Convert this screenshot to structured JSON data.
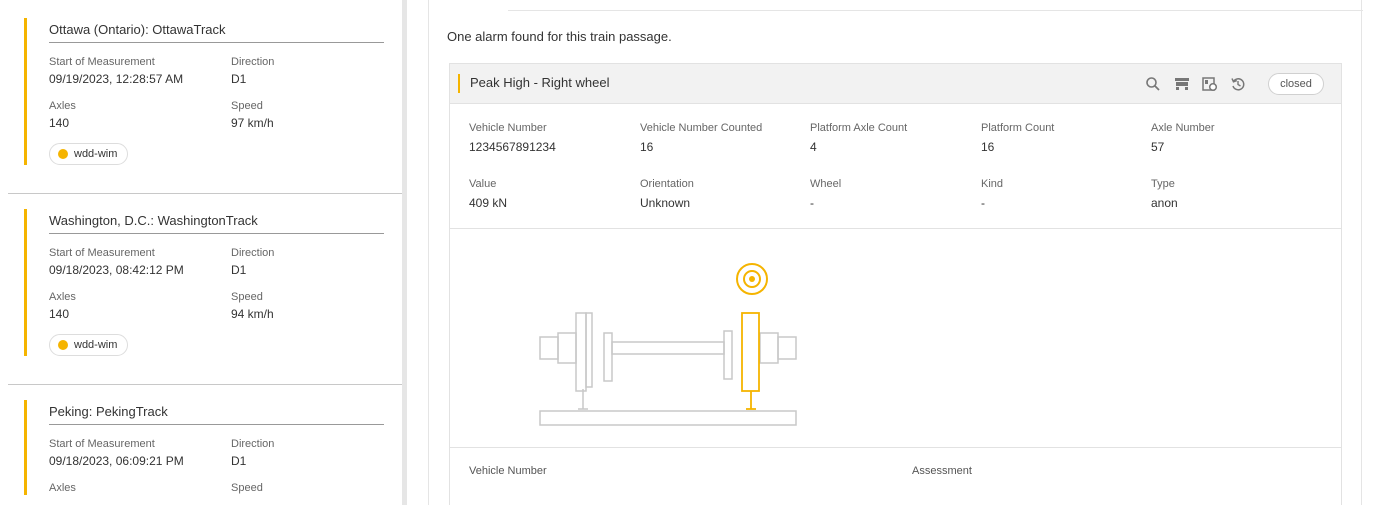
{
  "passages": [
    {
      "title": "Ottawa (Ontario): OttawaTrack",
      "start_label": "Start of Measurement",
      "start_value": "09/19/2023, 12:28:57 AM",
      "direction_label": "Direction",
      "direction_value": "D1",
      "axles_label": "Axles",
      "axles_value": "140",
      "speed_label": "Speed",
      "speed_value": "97 km/h",
      "tag": "wdd-wim"
    },
    {
      "title": "Washington, D.C.: WashingtonTrack",
      "start_label": "Start of Measurement",
      "start_value": "09/18/2023, 08:42:12 PM",
      "direction_label": "Direction",
      "direction_value": "D1",
      "axles_label": "Axles",
      "axles_value": "140",
      "speed_label": "Speed",
      "speed_value": "94 km/h",
      "tag": "wdd-wim"
    },
    {
      "title": "Peking: PekingTrack",
      "start_label": "Start of Measurement",
      "start_value": "09/18/2023, 06:09:21 PM",
      "direction_label": "Direction",
      "direction_value": "D1",
      "axles_label": "Axles",
      "speed_label": "Speed"
    }
  ],
  "main": {
    "intro": "One alarm found for this train passage.",
    "alarm": {
      "title": "Peak High - Right wheel",
      "status": "closed",
      "icons": [
        "search-icon",
        "wagon-icon",
        "axle-camera-icon",
        "history-icon"
      ],
      "fields": [
        {
          "label": "Vehicle Number",
          "value": "1234567891234"
        },
        {
          "label": "Vehicle Number Counted",
          "value": "16"
        },
        {
          "label": "Platform Axle Count",
          "value": "4"
        },
        {
          "label": "Platform Count",
          "value": "16"
        },
        {
          "label": "Axle Number",
          "value": "57"
        },
        {
          "label": "Value",
          "value": "409 kN"
        },
        {
          "label": "Orientation",
          "value": "Unknown"
        },
        {
          "label": "Wheel",
          "value": "-"
        },
        {
          "label": "Kind",
          "value": "-"
        },
        {
          "label": "Type",
          "value": "anon"
        }
      ],
      "bottom_columns": [
        "Vehicle Number",
        "Assessment"
      ]
    },
    "colors": {
      "accent": "#f5b400",
      "muted": "#c8c8c8"
    }
  }
}
